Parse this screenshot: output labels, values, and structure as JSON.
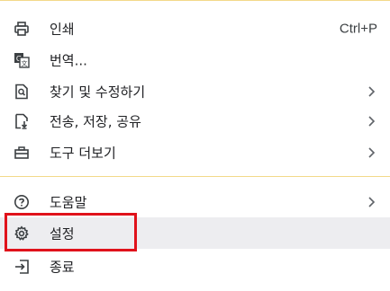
{
  "menu": {
    "items": [
      {
        "label": "인쇄",
        "shortcut": "Ctrl+P",
        "icon": "printer-icon"
      },
      {
        "label": "번역...",
        "icon": "translate-icon"
      },
      {
        "label": "찾기 및 수정하기",
        "icon": "find-page-icon",
        "submenu": true
      },
      {
        "label": "전송, 저장, 공유",
        "icon": "file-download-icon",
        "submenu": true
      },
      {
        "label": "도구 더보기",
        "icon": "toolbox-icon",
        "submenu": true
      },
      {
        "label": "도움말",
        "icon": "help-icon",
        "submenu": true
      },
      {
        "label": "설정",
        "icon": "gear-icon",
        "highlighted": true
      },
      {
        "label": "종료",
        "icon": "exit-icon"
      }
    ]
  },
  "colors": {
    "divider": "#f3d98a",
    "highlight_bg": "#ededf0",
    "annotation_border": "#e0121b"
  }
}
